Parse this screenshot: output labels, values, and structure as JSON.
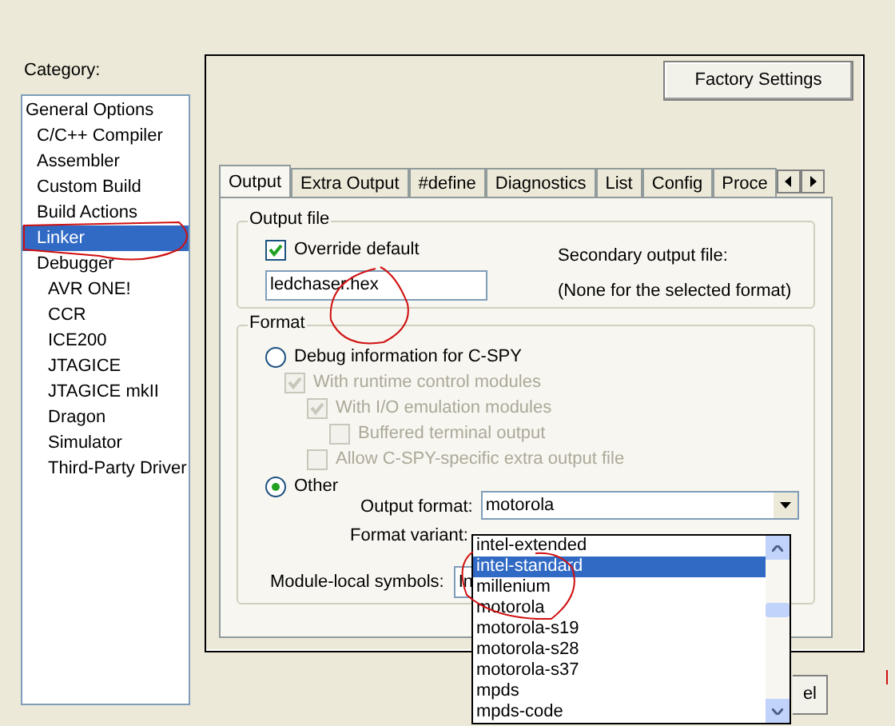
{
  "category": {
    "label": "Category:",
    "items": [
      {
        "label": "General Options",
        "selected": false,
        "children": [
          {
            "label": "C/C++ Compiler",
            "selected": false
          },
          {
            "label": "Assembler",
            "selected": false
          },
          {
            "label": "Custom Build",
            "selected": false
          },
          {
            "label": "Build Actions",
            "selected": false
          },
          {
            "label": "Linker",
            "selected": true
          },
          {
            "label": "Debugger",
            "selected": false,
            "children": [
              {
                "label": "AVR ONE!",
                "selected": false
              },
              {
                "label": "CCR",
                "selected": false
              },
              {
                "label": "ICE200",
                "selected": false
              },
              {
                "label": "JTAGICE",
                "selected": false
              },
              {
                "label": "JTAGICE mkII",
                "selected": false
              },
              {
                "label": "Dragon",
                "selected": false
              },
              {
                "label": "Simulator",
                "selected": false
              },
              {
                "label": "Third-Party Driver",
                "selected": false
              }
            ]
          }
        ]
      }
    ]
  },
  "factory_button": "Factory Settings",
  "tabs": [
    {
      "label": "Output",
      "selected": true
    },
    {
      "label": "Extra Output",
      "selected": false
    },
    {
      "label": "#define",
      "selected": false
    },
    {
      "label": "Diagnostics",
      "selected": false
    },
    {
      "label": "List",
      "selected": false
    },
    {
      "label": "Config",
      "selected": false
    },
    {
      "label": "Proce",
      "selected": false
    }
  ],
  "output_file": {
    "title": "Output file",
    "override": {
      "label": "Override default",
      "checked": true
    },
    "filename": "ledchaser.hex",
    "secondary_label": "Secondary output file:",
    "secondary_note": "(None for the selected format)"
  },
  "format": {
    "title": "Format",
    "debug_radio": {
      "label": "Debug information for C-SPY",
      "selected": false
    },
    "debug_options": [
      {
        "label": "With runtime control modules",
        "checked": true,
        "disabled": true,
        "children": [
          {
            "label": "With I/O emulation modules",
            "checked": true,
            "disabled": true,
            "children": [
              {
                "label": "Buffered terminal output",
                "checked": false,
                "disabled": true
              }
            ]
          },
          {
            "label": "Allow C-SPY-specific extra output file",
            "checked": false,
            "disabled": true
          }
        ]
      }
    ],
    "other_radio": {
      "label": "Other",
      "selected": true
    },
    "output_format": {
      "label": "Output format:",
      "value": "motorola"
    },
    "format_variant": {
      "label": "Format variant:"
    },
    "module_local": {
      "label": "Module-local symbols:",
      "value": "In"
    }
  },
  "dropdown": {
    "items": [
      {
        "label": "intel-extended",
        "selected": false
      },
      {
        "label": "intel-standard",
        "selected": true
      },
      {
        "label": "millenium",
        "selected": false
      },
      {
        "label": "motorola",
        "selected": false
      },
      {
        "label": "motorola-s19",
        "selected": false
      },
      {
        "label": "motorola-s28",
        "selected": false
      },
      {
        "label": "motorola-s37",
        "selected": false
      },
      {
        "label": "mpds",
        "selected": false
      },
      {
        "label": "mpds-code",
        "selected": false
      }
    ]
  },
  "cancel_button": "el"
}
